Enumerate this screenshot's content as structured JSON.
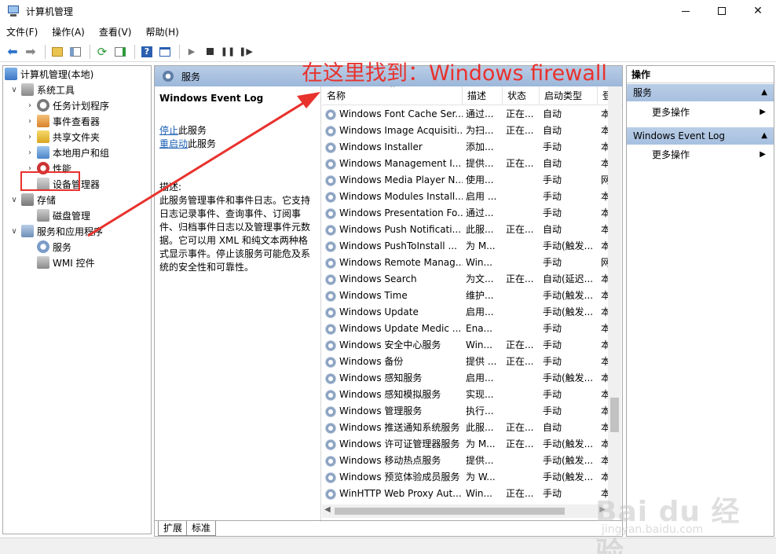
{
  "window": {
    "title": "计算机管理"
  },
  "menu": [
    "文件(F)",
    "操作(A)",
    "查看(V)",
    "帮助(H)"
  ],
  "tree": [
    {
      "label": "计算机管理(本地)",
      "exp": "",
      "icon": "computer-icon",
      "cls": "ic-comp",
      "level": 0
    },
    {
      "label": "系统工具",
      "exp": "∨",
      "icon": "tools-icon",
      "cls": "ic-tool",
      "level": 1
    },
    {
      "label": "任务计划程序",
      "exp": "›",
      "icon": "clock-icon",
      "cls": "ic-clock",
      "level": 2
    },
    {
      "label": "事件查看器",
      "exp": "›",
      "icon": "event-viewer-icon",
      "cls": "ic-event",
      "level": 2
    },
    {
      "label": "共享文件夹",
      "exp": "›",
      "icon": "shared-folder-icon",
      "cls": "ic-share",
      "level": 2
    },
    {
      "label": "本地用户和组",
      "exp": "›",
      "icon": "users-icon",
      "cls": "ic-users",
      "level": 2
    },
    {
      "label": "性能",
      "exp": "›",
      "icon": "performance-icon",
      "cls": "ic-perf",
      "level": 2
    },
    {
      "label": "设备管理器",
      "exp": "",
      "icon": "device-manager-icon",
      "cls": "ic-dev",
      "level": 2
    },
    {
      "label": "存储",
      "exp": "∨",
      "icon": "storage-icon",
      "cls": "ic-store",
      "level": 1
    },
    {
      "label": "磁盘管理",
      "exp": "",
      "icon": "disk-icon",
      "cls": "ic-disk",
      "level": 2
    },
    {
      "label": "服务和应用程序",
      "exp": "∨",
      "icon": "services-apps-icon",
      "cls": "ic-svcapp",
      "level": 1
    },
    {
      "label": "服务",
      "exp": "",
      "icon": "gear-icon",
      "cls": "ic-gear",
      "level": 2
    },
    {
      "label": "WMI 控件",
      "exp": "",
      "icon": "wmi-icon",
      "cls": "ic-wmi",
      "level": 2
    }
  ],
  "middle": {
    "header": "服务",
    "selected_service": "Windows Event Log",
    "stop_link": "停止",
    "stop_suffix": "此服务",
    "restart_link": "重启动",
    "restart_suffix": "此服务",
    "desc_label": "描述:",
    "desc_text": "此服务管理事件和事件日志。它支持日志记录事件、查询事件、订阅事件、归档事件日志以及管理事件元数据。它可以用 XML 和纯文本两种格式显示事件。停止该服务可能危及系统的安全性和可靠性。",
    "columns": [
      "名称",
      "描述",
      "状态",
      "启动类型",
      "登"
    ],
    "sort_indicator": "^",
    "rows": [
      [
        "Windows Font Cache Ser...",
        "通过...",
        "正在...",
        "自动",
        "本"
      ],
      [
        "Windows Image Acquisiti...",
        "为扫...",
        "正在...",
        "自动",
        "本"
      ],
      [
        "Windows Installer",
        "添加...",
        "",
        "手动",
        "本"
      ],
      [
        "Windows Management I...",
        "提供...",
        "正在...",
        "自动",
        "本"
      ],
      [
        "Windows Media Player N...",
        "使用...",
        "",
        "手动",
        "网"
      ],
      [
        "Windows Modules Install...",
        "启用 ...",
        "",
        "手动",
        "本"
      ],
      [
        "Windows Presentation Fo...",
        "通过...",
        "",
        "手动",
        "本"
      ],
      [
        "Windows Push Notificati...",
        "此服...",
        "正在...",
        "自动",
        "本"
      ],
      [
        "Windows PushToInstall ...",
        "为 M...",
        "",
        "手动(触发...",
        "本"
      ],
      [
        "Windows Remote Manag...",
        "Win...",
        "",
        "手动",
        "网"
      ],
      [
        "Windows Search",
        "为文...",
        "正在...",
        "自动(延迟...",
        "本"
      ],
      [
        "Windows Time",
        "维护...",
        "",
        "手动(触发...",
        "本"
      ],
      [
        "Windows Update",
        "启用...",
        "",
        "手动(触发...",
        "本"
      ],
      [
        "Windows Update Medic ...",
        "Ena...",
        "",
        "手动",
        "本"
      ],
      [
        "Windows 安全中心服务",
        "Win...",
        "正在...",
        "手动",
        "本"
      ],
      [
        "Windows 备份",
        "提供 ...",
        "正在...",
        "手动",
        "本"
      ],
      [
        "Windows 感知服务",
        "启用...",
        "",
        "手动(触发...",
        "本"
      ],
      [
        "Windows 感知模拟服务",
        "实现...",
        "",
        "手动",
        "本"
      ],
      [
        "Windows 管理服务",
        "执行...",
        "",
        "手动",
        "本"
      ],
      [
        "Windows 推送通知系统服务",
        "此服...",
        "正在...",
        "自动",
        "本"
      ],
      [
        "Windows 许可证管理器服务",
        "为 M...",
        "正在...",
        "手动(触发...",
        "本"
      ],
      [
        "Windows 移动热点服务",
        "提供...",
        "",
        "手动(触发...",
        "本"
      ],
      [
        "Windows 预览体验成员服务",
        "为 W...",
        "",
        "手动(触发...",
        "本"
      ],
      [
        "WinHTTP Web Proxy Aut...",
        "Win...",
        "正在...",
        "手动",
        "本"
      ]
    ],
    "tabs": [
      "扩展",
      "标准"
    ]
  },
  "annotation": "在这里找到：Windows firewall",
  "actions": {
    "title": "操作",
    "section1": "服务",
    "section1_item": "更多操作",
    "section2": "Windows Event Log",
    "section2_item": "更多操作"
  },
  "watermark": {
    "brand": "Bai du 经验",
    "sub": "jingyan.baidu.com"
  },
  "colors": {
    "annotation": "#e8322d",
    "header": "#b9cde6",
    "link": "#1a5fb4"
  }
}
